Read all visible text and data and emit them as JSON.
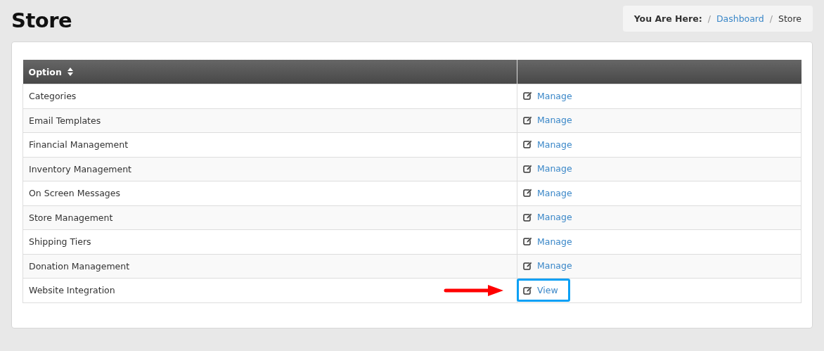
{
  "page_title": "Store",
  "breadcrumb": {
    "label": "You Are Here:",
    "separator": "/",
    "items": [
      {
        "text": "Dashboard",
        "kind": "link"
      },
      {
        "text": "Store",
        "kind": "current"
      }
    ]
  },
  "table": {
    "columns": [
      {
        "label": "Option",
        "sortable": true
      },
      {
        "sortable": false
      }
    ],
    "rows": [
      {
        "option": "Categories",
        "action": "Manage",
        "highlighted": false
      },
      {
        "option": "Email Templates",
        "action": "Manage",
        "highlighted": false
      },
      {
        "option": "Financial Management",
        "action": "Manage",
        "highlighted": false
      },
      {
        "option": "Inventory Management",
        "action": "Manage",
        "highlighted": false
      },
      {
        "option": "On Screen Messages",
        "action": "Manage",
        "highlighted": false
      },
      {
        "option": "Store Management",
        "action": "Manage",
        "highlighted": false
      },
      {
        "option": "Shipping Tiers",
        "action": "Manage",
        "highlighted": false
      },
      {
        "option": "Donation Management",
        "action": "Manage",
        "highlighted": false
      },
      {
        "option": "Website Integration",
        "action": "View",
        "highlighted": true
      }
    ]
  }
}
